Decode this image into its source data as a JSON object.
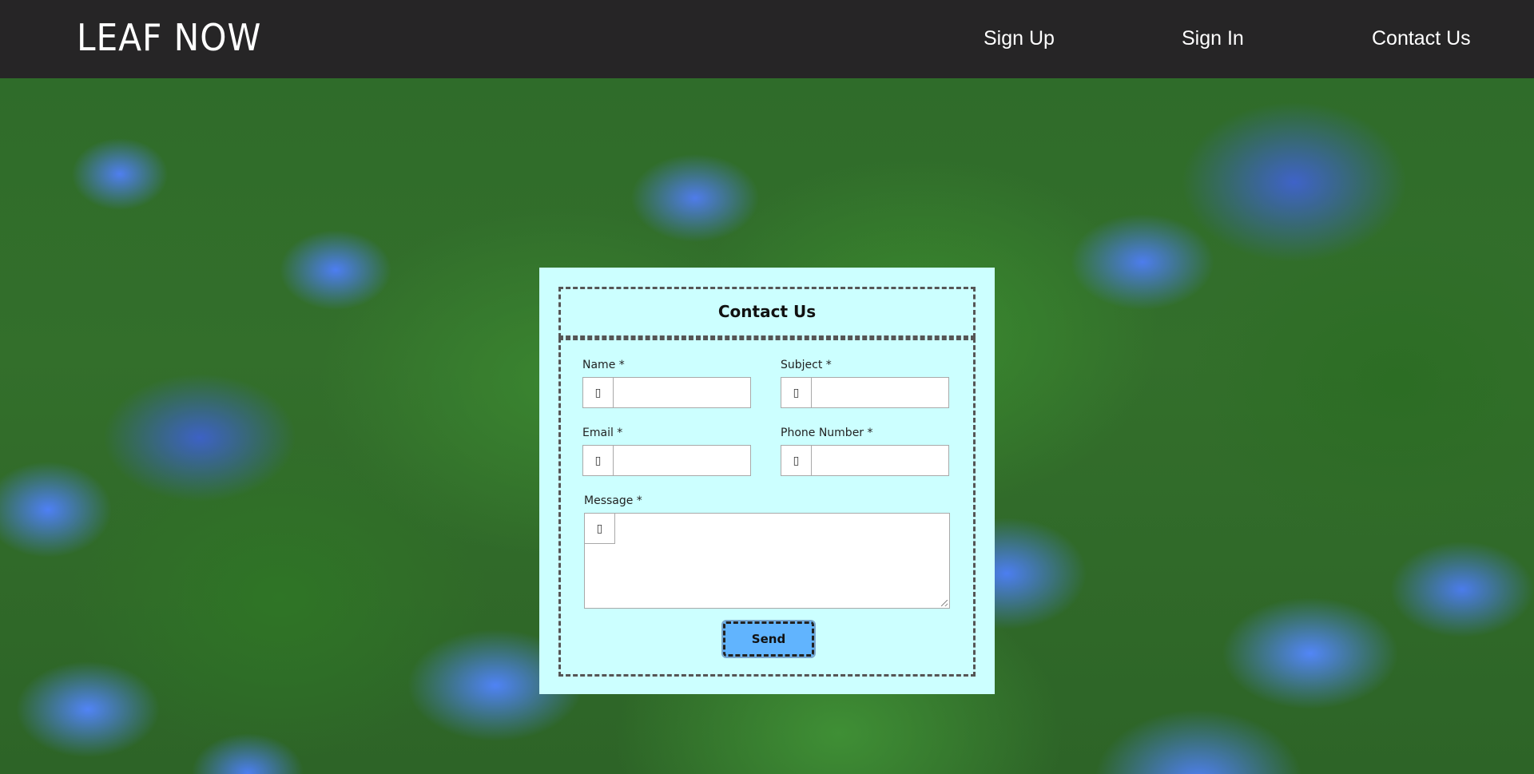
{
  "navbar": {
    "logo": "LEAF NOW",
    "links": {
      "sign_up": "Sign Up",
      "sign_in": "Sign In",
      "contact_us": "Contact Us"
    }
  },
  "form": {
    "title": "Contact Us",
    "fields": {
      "name": {
        "label": "Name *",
        "value": "",
        "icon": "user-icon"
      },
      "subject": {
        "label": "Subject *",
        "value": "",
        "icon": "subject-icon"
      },
      "email": {
        "label": "Email *",
        "value": "",
        "icon": "email-icon"
      },
      "phone": {
        "label": "Phone Number *",
        "value": "",
        "icon": "phone-icon"
      },
      "message": {
        "label": "Message *",
        "value": "",
        "icon": "message-icon"
      }
    },
    "submit_label": "Send"
  },
  "colors": {
    "navbar_bg": "#262526",
    "card_bg": "#ccffff",
    "button_bg": "#61b4fe"
  },
  "background_image": "blue forget-me-not flowers on green foliage"
}
